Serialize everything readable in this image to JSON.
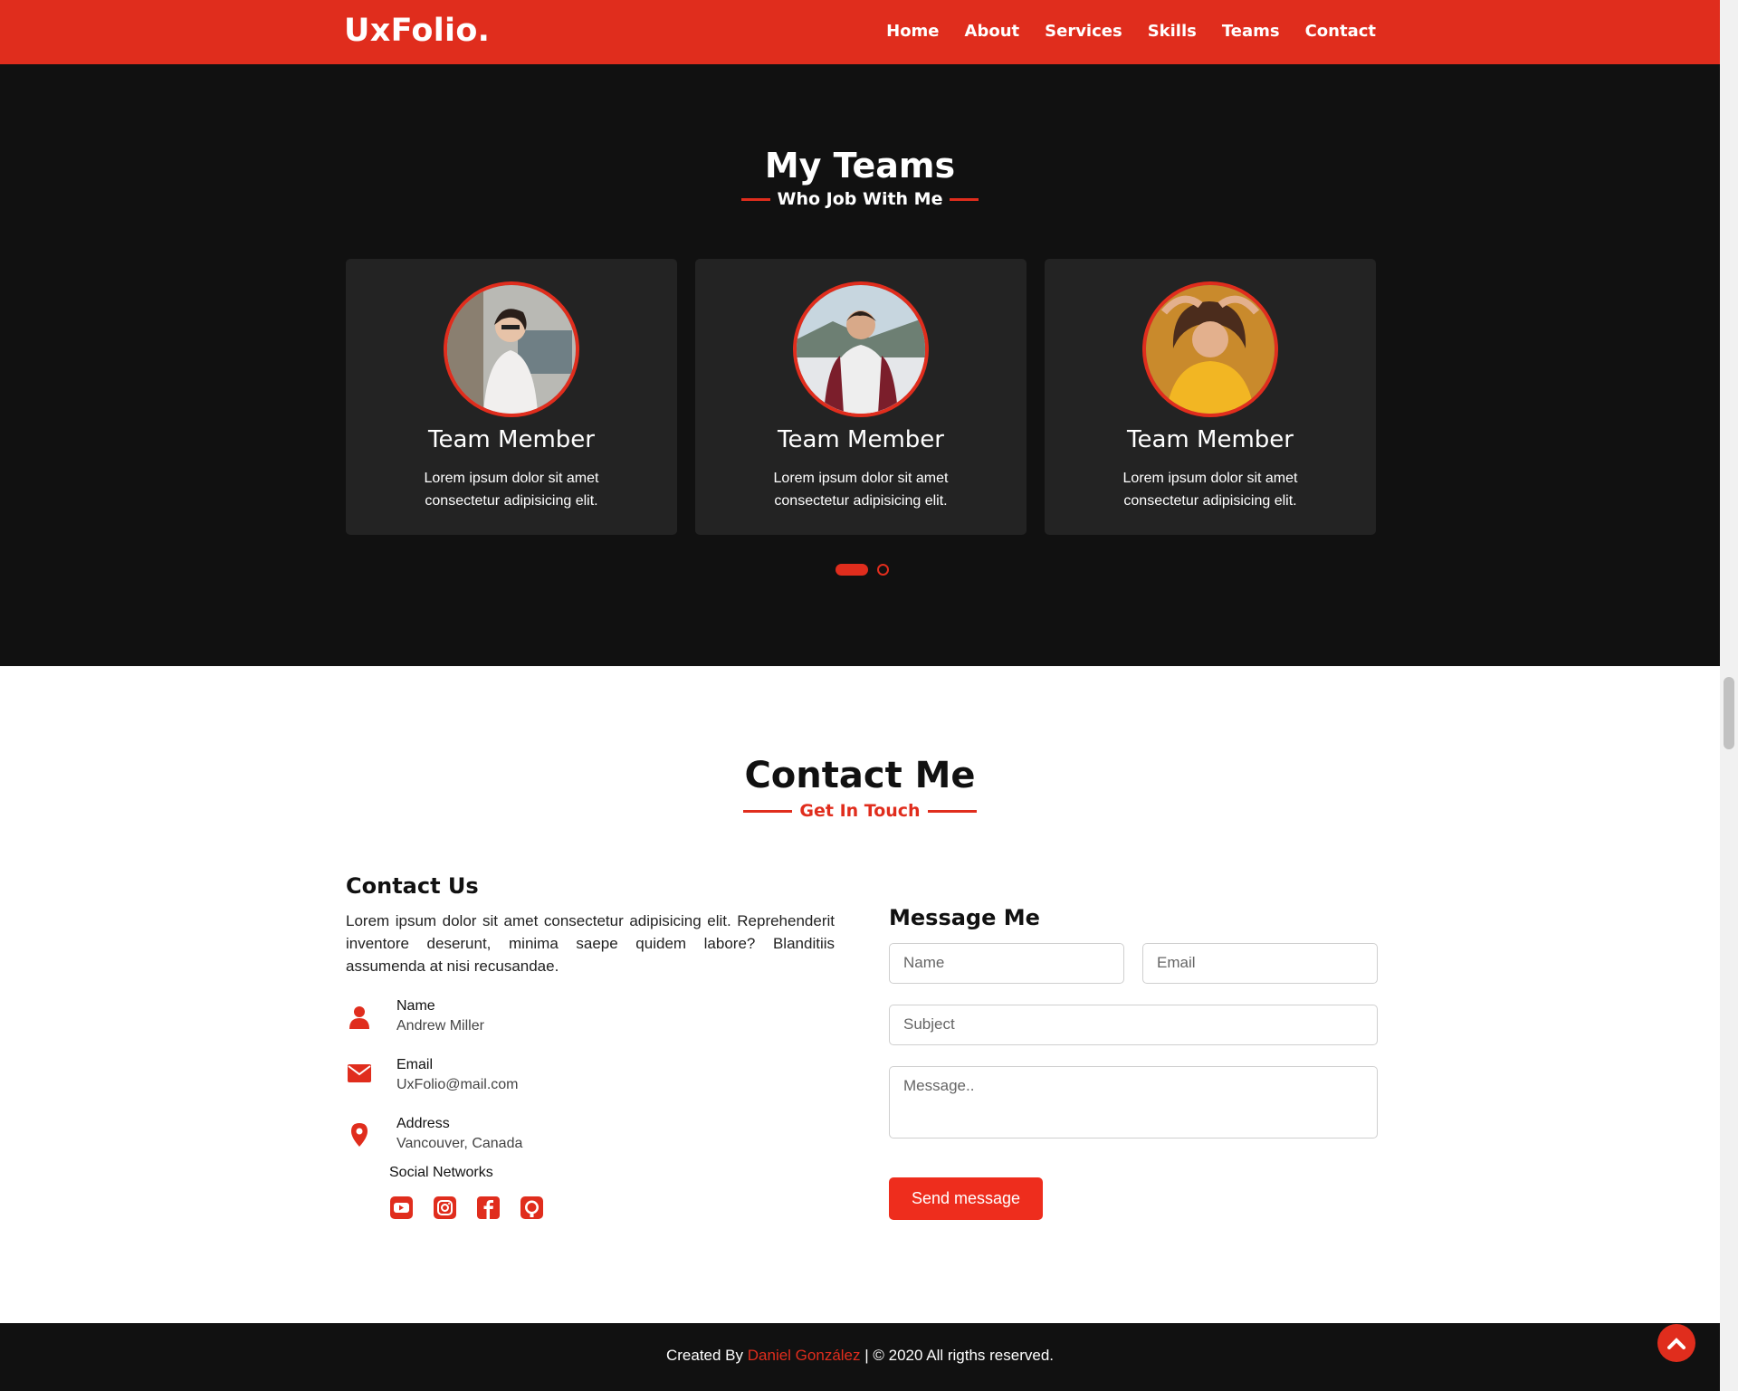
{
  "brand": "UxFolio.",
  "nav": [
    "Home",
    "About",
    "Services",
    "Skills",
    "Teams",
    "Contact"
  ],
  "teams": {
    "title": "My Teams",
    "subtitle": "Who Job With Me",
    "cards": [
      {
        "name": "Team Member",
        "desc": "Lorem ipsum dolor sit amet consectetur adipisicing elit."
      },
      {
        "name": "Team Member",
        "desc": "Lorem ipsum dolor sit amet consectetur adipisicing elit."
      },
      {
        "name": "Team Member",
        "desc": "Lorem ipsum dolor sit amet consectetur adipisicing elit."
      }
    ]
  },
  "contact": {
    "title": "Contact Me",
    "subtitle": "Get In Touch",
    "left_title": "Contact Us",
    "intro": "Lorem ipsum dolor sit amet consectetur adipisicing elit. Reprehenderit inventore deserunt, minima saepe quidem labore? Blanditiis assumenda at nisi recusandae.",
    "info": [
      {
        "label": "Name",
        "value": "Andrew Miller",
        "icon": "user-icon"
      },
      {
        "label": "Email",
        "value": "UxFolio@mail.com",
        "icon": "envelope-icon"
      },
      {
        "label": "Address",
        "value": "Vancouver, Canada",
        "icon": "map-pin-icon"
      }
    ],
    "social_title": "Social Networks",
    "social_icons": [
      "youtube-icon",
      "instagram-icon",
      "facebook-icon",
      "github-icon"
    ],
    "form_title": "Message Me",
    "placeholders": {
      "name": "Name",
      "email": "Email",
      "subject": "Subject",
      "message": "Message.."
    },
    "send_label": "Send message"
  },
  "footer": {
    "created_by": "Created By",
    "author": "Daniel González",
    "rights": "| © 2020 All rigths reserved."
  },
  "colors": {
    "accent": "#e02d1d",
    "dark": "#111111",
    "card": "#232323"
  }
}
